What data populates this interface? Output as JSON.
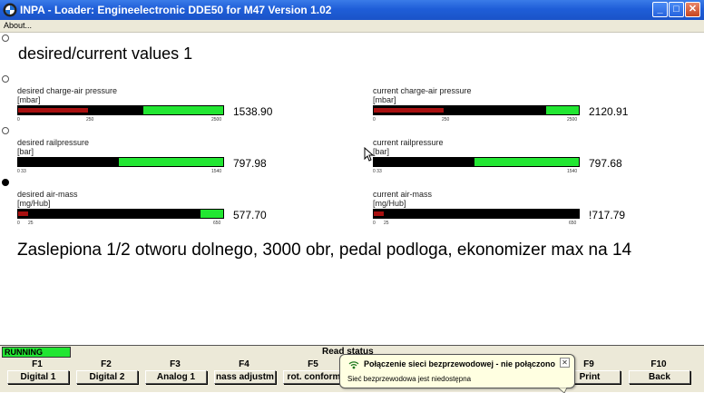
{
  "window": {
    "title": "INPA - Loader:  Engineelectronic DDE50 for M47 Version 1.02",
    "minimize_glyph": "_",
    "maximize_glyph": "□",
    "close_glyph": "✕"
  },
  "menu": {
    "about_label": "About..."
  },
  "page": {
    "title": "desired/current values 1"
  },
  "gauges": [
    {
      "id": "desired-charge-air-pressure",
      "label": "desired charge-air pressure",
      "unit": "[mbar]",
      "value_text": "1538.90",
      "ticks": [
        "0",
        "250",
        "2500"
      ],
      "fill_fraction": 0.61,
      "red_fraction": 0.34
    },
    {
      "id": "current-charge-air-pressure",
      "label": "current charge-air pressure",
      "unit": "[mbar]",
      "value_text": "2120.91",
      "ticks": [
        "0",
        "250",
        "2500"
      ],
      "fill_fraction": 0.84,
      "red_fraction": 0.34
    },
    {
      "id": "desired-railpressure",
      "label": "desired railpressure",
      "unit": "[bar]",
      "value_text": "797.98",
      "ticks": [
        "0 33",
        "1540"
      ],
      "fill_fraction": 0.49,
      "red_fraction": 0.0
    },
    {
      "id": "current-railpressure",
      "label": "current railpressure",
      "unit": "[bar]",
      "value_text": "797.68",
      "ticks": [
        "0 33",
        "1540"
      ],
      "fill_fraction": 0.49,
      "red_fraction": 0.0
    },
    {
      "id": "desired-air-mass",
      "label": "desired air-mass",
      "unit": "[mg/Hub]",
      "value_text": "577.70",
      "ticks": [
        "0",
        "25",
        "650"
      ],
      "fill_fraction": 0.89,
      "red_fraction": 0.05
    },
    {
      "id": "current-air-mass",
      "label": "current air-mass",
      "unit": "[mg/Hub]",
      "value_text": "!717.79",
      "ticks": [
        "0",
        "25",
        "650"
      ],
      "fill_fraction": 1.0,
      "red_fraction": 0.05
    }
  ],
  "comment": {
    "text": "Zaslepiona 1/2 otworu dolnego, 3000 obr, pedal podloga, ekonomizer max na 14"
  },
  "status": {
    "running": "RUNNING",
    "read_status": "Read status"
  },
  "fkeys": [
    {
      "key": "F1",
      "label": "Digital 1"
    },
    {
      "key": "F2",
      "label": "Digital 2"
    },
    {
      "key": "F3",
      "label": "Analog 1"
    },
    {
      "key": "F4",
      "label": "nass adjustm"
    },
    {
      "key": "F5",
      "label": "rot. conform"
    },
    {
      "key": "F6",
      "label": ""
    },
    {
      "key": "F7",
      "label": ""
    },
    {
      "key": "F8",
      "label": ""
    },
    {
      "key": "F9",
      "label": "Print"
    },
    {
      "key": "F10",
      "label": "Back"
    }
  ],
  "notification": {
    "title": "Połączenie sieci bezprzewodowej - nie połączono",
    "text": "Sieć bezprzewodowa jest niedostępna",
    "icon": "wireless-icon",
    "close_glyph": "✕"
  },
  "colors": {
    "bar_green": "#22e632",
    "bar_black": "#000000",
    "bar_red": "#a81010",
    "titlebar_blue": "#1f5ed8"
  }
}
